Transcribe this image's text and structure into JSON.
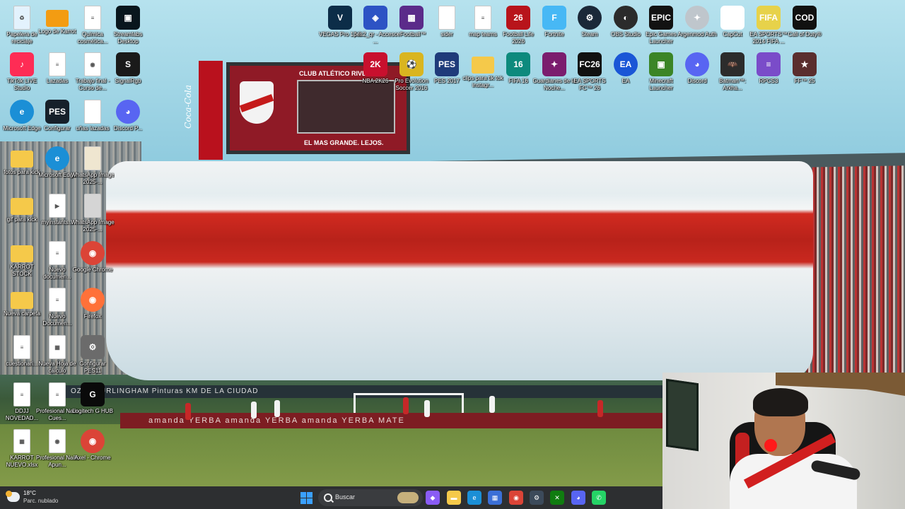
{
  "scene": {
    "scoreboard_title": "CLUB ATLÉTICO RIVER",
    "scoreboard_slogan": "EL MAS GRANDE. LEJOS.",
    "coke_text": "Coca-Cola",
    "adboard_text": "amanda    YERBA    amanda    YERBA    amanda    YERBA MATE",
    "adboard2_text": "OZZY    BURLINGHAM    Pinturas    KM    DE LA CIUDAD"
  },
  "desktop_icons": [
    {
      "label": "Papelera de reciclaje",
      "icon": "recycle-bin-icon",
      "style": "doc",
      "color": "#e3f2fd",
      "glyph": "♻"
    },
    {
      "label": "Logo de Karrot",
      "icon": "image-file-icon",
      "style": "folder",
      "color": "#f39c12",
      "glyph": ""
    },
    {
      "label": "Química cosmética...",
      "icon": "document-icon",
      "style": "doc",
      "color": "#ffffff",
      "glyph": "≡"
    },
    {
      "label": "Streamlabs Desktop",
      "icon": "streamlabs-icon",
      "style": "app",
      "color": "#09161d",
      "glyph": "▣"
    },
    {
      "label": "TikTok LIVE Studio",
      "icon": "tiktok-icon",
      "style": "app",
      "color": "#fe2c55",
      "glyph": "♪"
    },
    {
      "label": "Lazadas",
      "icon": "document-icon",
      "style": "doc",
      "color": "#ffffff",
      "glyph": "≡"
    },
    {
      "label": "Trabajo final - Curso de...",
      "icon": "chrome-doc-icon",
      "style": "doc",
      "color": "#ffffff",
      "glyph": "◉"
    },
    {
      "label": "SignalRgb",
      "icon": "signalrgb-icon",
      "style": "app",
      "color": "#1a1a1a",
      "glyph": "S"
    },
    {
      "label": "Microsoft Edge",
      "icon": "edge-icon",
      "style": "round",
      "color": "#1b8fd6",
      "glyph": "e"
    },
    {
      "label": "Configurar",
      "icon": "pes-config-icon",
      "style": "app",
      "color": "#16202a",
      "glyph": "PES"
    },
    {
      "label": "uñas lazadas",
      "icon": "document-icon",
      "style": "doc",
      "color": "#ffffff",
      "glyph": ""
    },
    {
      "label": "Discord P...",
      "icon": "discord-icon",
      "style": "round",
      "color": "#5865f2",
      "glyph": "◕"
    },
    {
      "label": "fotos para kick",
      "icon": "folder-icon",
      "style": "folder",
      "color": "#f5c94a",
      "glyph": ""
    },
    {
      "label": "Microsoft Edge",
      "icon": "edge-icon",
      "style": "round",
      "color": "#1b8fd6",
      "glyph": "e"
    },
    {
      "label": "WhatsApp Image 2025-...",
      "icon": "image-file-icon",
      "style": "doc",
      "color": "#efe6d0",
      "glyph": ""
    },
    {
      "label": "gif para kick",
      "icon": "folder-icon",
      "style": "folder",
      "color": "#f5c94a",
      "glyph": ""
    },
    {
      "label": "myinstants...",
      "icon": "media-file-icon",
      "style": "doc",
      "color": "#ffffff",
      "glyph": "▶"
    },
    {
      "label": "WhatsApp Image 2025-...",
      "icon": "image-file-icon",
      "style": "doc",
      "color": "#d5d5d5",
      "glyph": ""
    },
    {
      "label": "KARROT STOCK",
      "icon": "folder-icon",
      "style": "folder",
      "color": "#f5c94a",
      "glyph": ""
    },
    {
      "label": "Nuevo documen...",
      "icon": "document-icon",
      "style": "doc",
      "color": "#ffffff",
      "glyph": "≡"
    },
    {
      "label": "Google Chrome",
      "icon": "chrome-icon",
      "style": "round",
      "color": "#db4437",
      "glyph": "◉"
    },
    {
      "label": "Nueva carpeta",
      "icon": "folder-icon",
      "style": "folder",
      "color": "#f5c94a",
      "glyph": ""
    },
    {
      "label": "Nuevo Documen...",
      "icon": "document-icon",
      "style": "doc",
      "color": "#ffffff",
      "glyph": "≡"
    },
    {
      "label": "Firefox",
      "icon": "firefox-icon",
      "style": "round",
      "color": "#ff7139",
      "glyph": "◉"
    },
    {
      "label": "cuestionari...",
      "icon": "document-icon",
      "style": "doc",
      "color": "#ffffff",
      "glyph": "≡"
    },
    {
      "label": "Nueva Hoja de cálculo",
      "icon": "spreadsheet-icon",
      "style": "doc",
      "color": "#ffffff",
      "glyph": "▦"
    },
    {
      "label": "Configurar PES11",
      "icon": "pes11-config-icon",
      "style": "app",
      "color": "#6b6b6b",
      "glyph": "⚙"
    },
    {
      "label": "DDJJ NOVEDAD...",
      "icon": "document-icon",
      "style": "doc",
      "color": "#ffffff",
      "glyph": "≡"
    },
    {
      "label": "Profesional Nails Cues...",
      "icon": "document-icon",
      "style": "doc",
      "color": "#ffffff",
      "glyph": "≡"
    },
    {
      "label": "Logitech G HUB",
      "icon": "logitech-icon",
      "style": "app",
      "color": "#0a0a0a",
      "glyph": "G"
    },
    {
      "label": "KARROT NUEVO.xlsx",
      "icon": "excel-file-icon",
      "style": "doc",
      "color": "#ffffff",
      "glyph": "▦"
    },
    {
      "label": "Profesional Nails Apun...",
      "icon": "chrome-doc-icon",
      "style": "doc",
      "color": "#ffffff",
      "glyph": "◉"
    },
    {
      "label": "Axel - Chrome",
      "icon": "chrome-icon",
      "style": "round",
      "color": "#db4437",
      "glyph": "◉"
    },
    {
      "label": "VEGAS Pro 17.0",
      "icon": "vegas-icon",
      "style": "app",
      "color": "#0c2d48",
      "glyph": "V"
    },
    {
      "label": "pes2_qr - Acceso ...",
      "icon": "pes-qr-icon",
      "style": "app",
      "color": "#2d53c4",
      "glyph": "◈"
    },
    {
      "label": "eFootball™",
      "icon": "efootball-icon",
      "style": "app",
      "color": "#5b2b8a",
      "glyph": "▩"
    },
    {
      "label": "sider",
      "icon": "document-icon",
      "style": "doc",
      "color": "#ffffff",
      "glyph": ""
    },
    {
      "label": "map teams",
      "icon": "document-icon",
      "style": "doc",
      "color": "#ffffff",
      "glyph": "≡"
    },
    {
      "label": "Football Life 2026",
      "icon": "football-life-icon",
      "style": "app",
      "color": "#b8141b",
      "glyph": "26"
    },
    {
      "label": "Fortnite",
      "icon": "fortnite-icon",
      "style": "app",
      "color": "#47b8f5",
      "glyph": "F"
    },
    {
      "label": "Steam",
      "icon": "steam-icon",
      "style": "round",
      "color": "#1b2838",
      "glyph": "⚙"
    },
    {
      "label": "OBS Studio",
      "icon": "obs-icon",
      "style": "round",
      "color": "#2b2b2b",
      "glyph": "◐"
    },
    {
      "label": "Epic Games Launcher",
      "icon": "epic-games-icon",
      "style": "app",
      "color": "#121212",
      "glyph": "EPIC"
    },
    {
      "label": "Argenmod Auth",
      "icon": "argenmod-icon",
      "style": "round",
      "color": "#bfc6cc",
      "glyph": "✦"
    },
    {
      "label": "CapCut",
      "icon": "capcut-icon",
      "style": "app",
      "color": "#ffffff",
      "glyph": "✂"
    },
    {
      "label": "EA SPORTS™ 2014 FIFA ...",
      "icon": "fifa-world-cup-icon",
      "style": "app",
      "color": "#e7d24a",
      "glyph": "FIFA"
    },
    {
      "label": "Call of Duty®",
      "icon": "call-of-duty-icon",
      "style": "app",
      "color": "#111111",
      "glyph": "COD"
    },
    {
      "label": "NBA 2K26",
      "icon": "nba2k-icon",
      "style": "app",
      "color": "#c8102e",
      "glyph": "2K"
    },
    {
      "label": "Pro Evolution Soccer 2016",
      "icon": "pes2016-icon",
      "style": "app",
      "color": "#d9b520",
      "glyph": "⚽"
    },
    {
      "label": "PES 2017",
      "icon": "pes2017-icon",
      "style": "app",
      "color": "#1f3b7a",
      "glyph": "PES"
    },
    {
      "label": "clips para tik tok instagr...",
      "icon": "folder-icon",
      "style": "folder",
      "color": "#f5c94a",
      "glyph": ""
    },
    {
      "label": "FIFA 16",
      "icon": "fifa16-icon",
      "style": "app",
      "color": "#0d8a7d",
      "glyph": "16"
    },
    {
      "label": "Guardianes de la Noche...",
      "icon": "game-icon",
      "style": "app",
      "color": "#7b1d6e",
      "glyph": "✦"
    },
    {
      "label": "EA SPORTS FC™ 26",
      "icon": "ea-fc-icon",
      "style": "app",
      "color": "#111111",
      "glyph": "FC26"
    },
    {
      "label": "EA",
      "icon": "ea-icon",
      "style": "round",
      "color": "#1a56d6",
      "glyph": "EA"
    },
    {
      "label": "Minecraft Launcher",
      "icon": "minecraft-icon",
      "style": "app",
      "color": "#3b8526",
      "glyph": "▣"
    },
    {
      "label": "Discord",
      "icon": "discord-icon",
      "style": "round",
      "color": "#5865f2",
      "glyph": "◕"
    },
    {
      "label": "Batman™: Arkha...",
      "icon": "batman-icon",
      "style": "app",
      "color": "#2c2c2c",
      "glyph": "🦇"
    },
    {
      "label": "RPCS3",
      "icon": "rpcs3-icon",
      "style": "app",
      "color": "#7a4cc9",
      "glyph": "≡"
    },
    {
      "label": "FF™ 25",
      "icon": "game-icon",
      "style": "app",
      "color": "#5a2e2e",
      "glyph": "★"
    }
  ],
  "taskbar": {
    "temperature": "18°C",
    "condition": "Parc. nublado",
    "search_placeholder": "Buscar",
    "apps": [
      {
        "name": "copilot-icon",
        "color": "#8a5cf5",
        "glyph": "◆"
      },
      {
        "name": "file-explorer-icon",
        "color": "#f5c94a",
        "glyph": "▬"
      },
      {
        "name": "edge-icon",
        "color": "#1b8fd6",
        "glyph": "e"
      },
      {
        "name": "store-icon",
        "color": "#3b6fd6",
        "glyph": "▦"
      },
      {
        "name": "chrome-icon",
        "color": "#db4437",
        "glyph": "◉"
      },
      {
        "name": "steam-icon",
        "color": "#3c4a5a",
        "glyph": "⚙"
      },
      {
        "name": "xbox-icon",
        "color": "#107c10",
        "glyph": "✕"
      },
      {
        "name": "discord-icon",
        "color": "#5865f2",
        "glyph": "◕"
      },
      {
        "name": "whatsapp-icon",
        "color": "#25d366",
        "glyph": "✆"
      }
    ]
  }
}
